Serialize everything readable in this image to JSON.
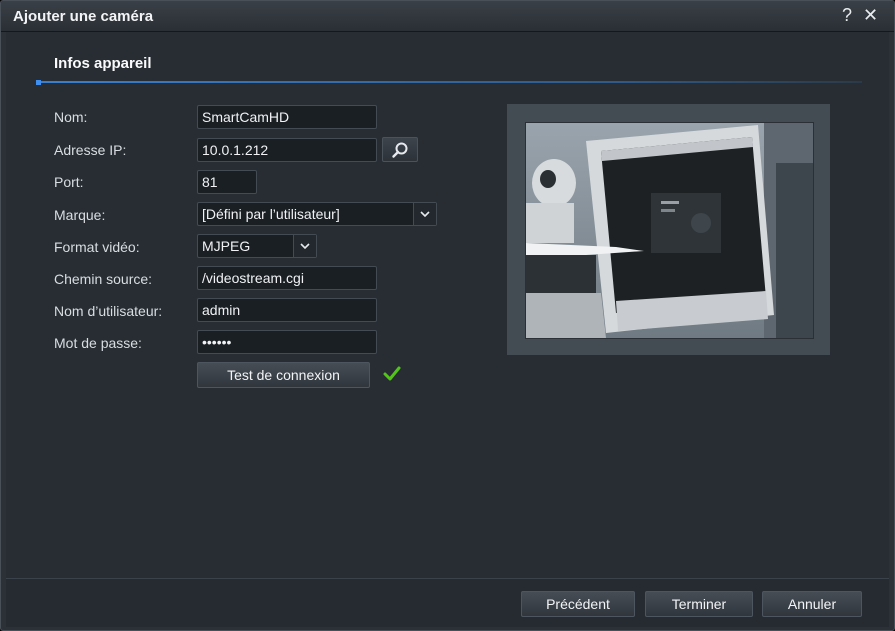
{
  "window": {
    "title": "Ajouter une caméra"
  },
  "section": {
    "title": "Infos appareil"
  },
  "form": {
    "name": {
      "label": "Nom:",
      "value": "SmartCamHD"
    },
    "ip": {
      "label": "Adresse IP:",
      "value": "10.0.1.212"
    },
    "port": {
      "label": "Port:",
      "value": "81"
    },
    "brand": {
      "label": "Marque:",
      "value": "[Défini par l’utilisateur]"
    },
    "video_format": {
      "label": "Format vidéo:",
      "value": "MJPEG"
    },
    "source_path": {
      "label": "Chemin source:",
      "value": "/videostream.cgi"
    },
    "username": {
      "label": "Nom d’utilisateur:",
      "value": "admin"
    },
    "password": {
      "label": "Mot de passe:",
      "value": "••••••"
    },
    "test_button": "Test de connexion"
  },
  "footer": {
    "previous": "Précédent",
    "finish": "Terminer",
    "cancel": "Annuler"
  },
  "colors": {
    "accent": "#3a7fd0",
    "check": "#52c41a"
  },
  "icons": [
    "help-icon",
    "close-icon",
    "search-icon",
    "chevron-down-icon",
    "check-icon"
  ]
}
